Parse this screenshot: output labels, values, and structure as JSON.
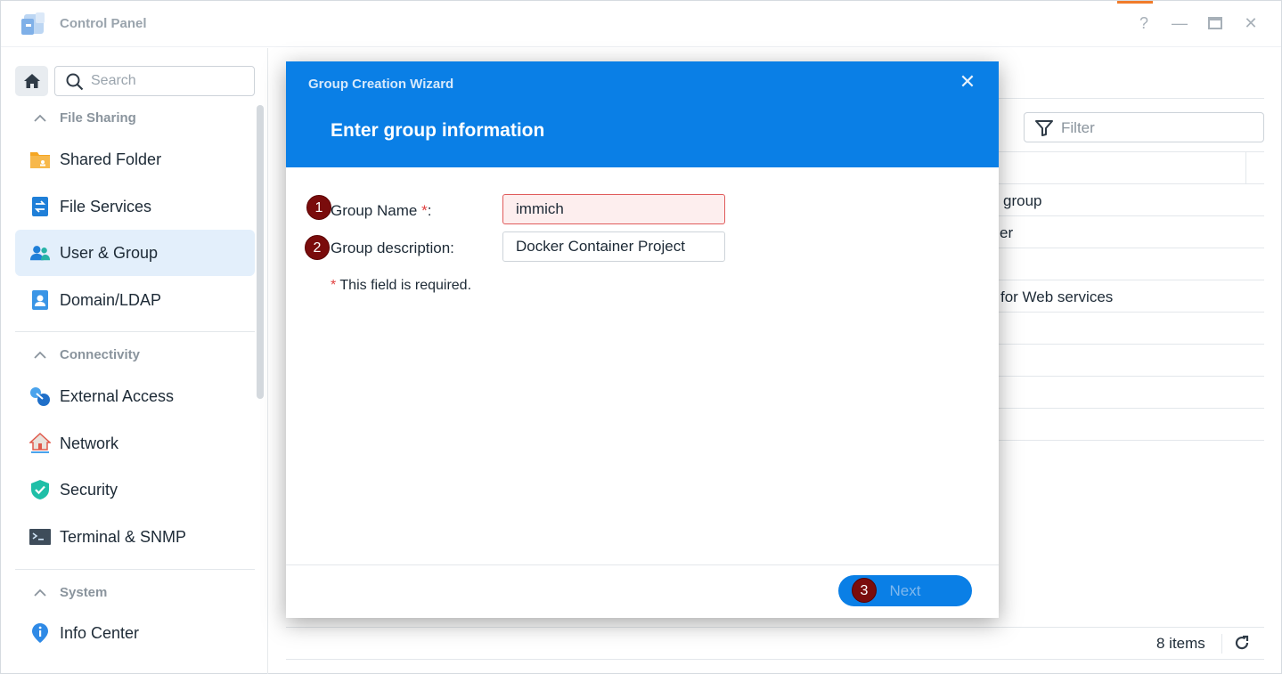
{
  "window": {
    "title": "Control Panel",
    "controls": {
      "help": "?",
      "minimize": "—",
      "maximize": "□",
      "close": "✕"
    }
  },
  "sidebar": {
    "search_placeholder": "Search",
    "sections": [
      {
        "label": "File Sharing"
      },
      {
        "label": "Connectivity"
      },
      {
        "label": "System"
      }
    ],
    "items": [
      {
        "label": "Shared Folder"
      },
      {
        "label": "File Services"
      },
      {
        "label": "User & Group",
        "active": true
      },
      {
        "label": "Domain/LDAP"
      },
      {
        "label": "External Access"
      },
      {
        "label": "Network"
      },
      {
        "label": "Security"
      },
      {
        "label": "Terminal & SNMP"
      },
      {
        "label": "Info Center"
      }
    ]
  },
  "main": {
    "filter_placeholder": "Filter",
    "rows": [
      {
        "text": "group"
      },
      {
        "text": "er"
      },
      {
        "text": "for Web services"
      }
    ],
    "items_count": "8 items"
  },
  "modal": {
    "wizard_title": "Group Creation Wizard",
    "step_title": "Enter group information",
    "fields": {
      "group_name": {
        "label": "Group Name",
        "required_mark": "*",
        "colon": ":",
        "value": "immich"
      },
      "group_description": {
        "label": "Group description:",
        "value": "Docker Container Project"
      }
    },
    "required_note": {
      "mark": "*",
      "text": "This field is required."
    },
    "next_label": "Next",
    "badges": [
      "1",
      "2",
      "3"
    ]
  },
  "colors": {
    "accent": "#0a7fe6",
    "active_bg": "#e3effb",
    "error_bg": "#fdeeee",
    "badge": "#7a0c0c"
  }
}
